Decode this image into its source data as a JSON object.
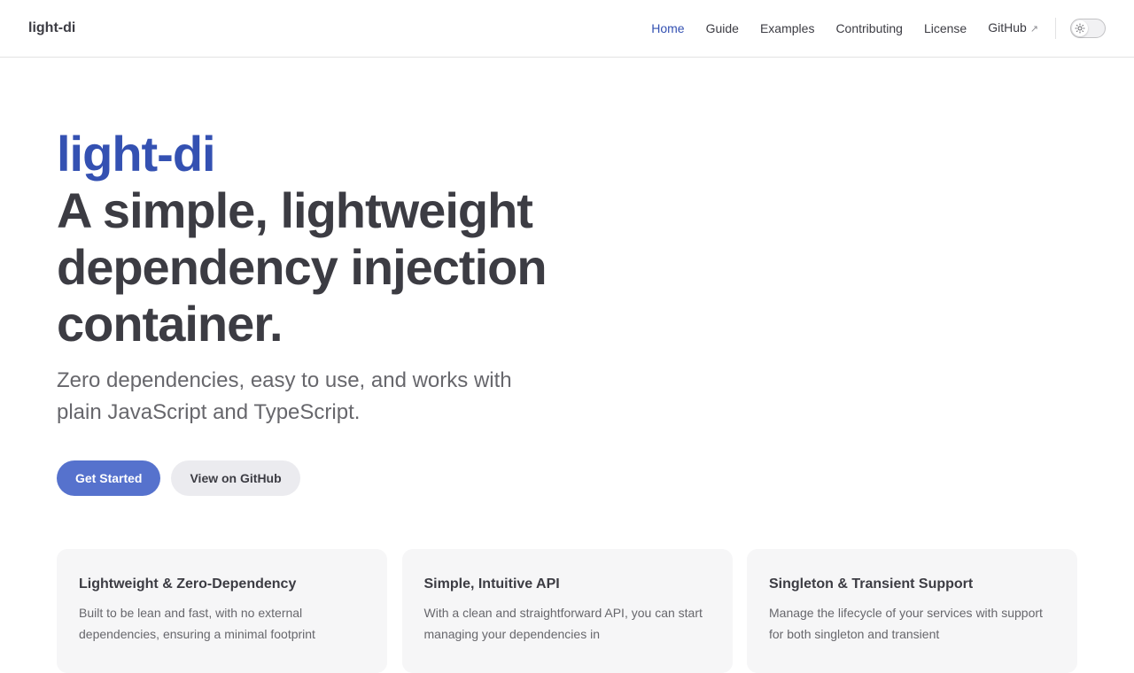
{
  "nav": {
    "brand": "light-di",
    "links": [
      {
        "label": "Home"
      },
      {
        "label": "Guide"
      },
      {
        "label": "Examples"
      },
      {
        "label": "Contributing"
      },
      {
        "label": "License"
      },
      {
        "label": "GitHub",
        "external_icon": "↗"
      }
    ],
    "theme_toggle_icon": "sun-icon"
  },
  "hero": {
    "name": "light-di",
    "text": "A simple, lightweight dependency injection container.",
    "tagline": "Zero dependencies, easy to use, and works with plain JavaScript and TypeScript.",
    "actions": [
      {
        "label": "Get Started"
      },
      {
        "label": "View on GitHub"
      }
    ]
  },
  "features": [
    {
      "title": "Lightweight & Zero-Dependency",
      "details": "Built to be lean and fast, with no external dependencies, ensuring a minimal footprint"
    },
    {
      "title": "Simple, Intuitive API",
      "details": "With a clean and straightforward API, you can start managing your dependencies in"
    },
    {
      "title": "Singleton & Transient Support",
      "details": "Manage the lifecycle of your services with support for both singleton and transient"
    }
  ],
  "colors": {
    "brand": "#3451b2",
    "button_brand": "#5672cd",
    "text": "#3c3c43",
    "muted": "#67676c"
  }
}
